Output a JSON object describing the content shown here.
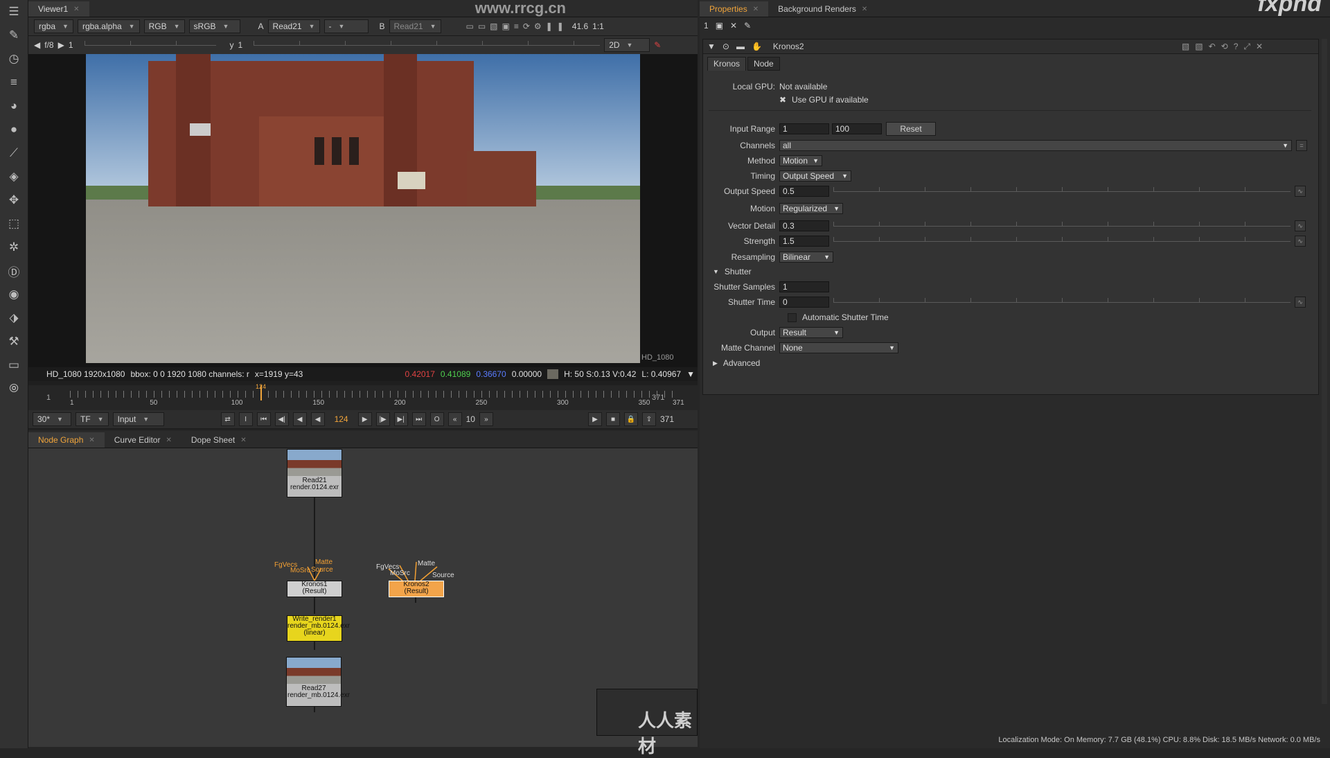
{
  "toolbar": {
    "icons": [
      "layers-icon",
      "paint-brush-icon",
      "clock-icon",
      "stack-icon",
      "sphere-icon",
      "circle-icon",
      "brush-icon",
      "layers-icon",
      "move-icon",
      "cube-icon",
      "particles-icon",
      "d-icon",
      "eye-icon",
      "tag-icon",
      "wrench-icon",
      "hdd-icon",
      "wand-icon"
    ]
  },
  "watermark": {
    "site": "www.rrcg.cn",
    "brand": "fxphd",
    "bottom_brand": "人人素材"
  },
  "viewer": {
    "tab": "Viewer1",
    "channels": "rgba",
    "alpha": "rgba.alpha",
    "colorspace": "RGB",
    "lut": "sRGB",
    "a_label": "A",
    "a_input": "Read21",
    "dash": "-",
    "b_label": "B",
    "b_input": "Read21",
    "zoom": "41.6",
    "ratio": "1:1",
    "fstop": "f/8",
    "gain": "1",
    "y_label": "y",
    "y_value": "1",
    "mode": "2D",
    "format_label": "HD_1080",
    "info_format": "HD_1080 1920x1080",
    "info_bbox": "bbox: 0 0 1920 1080 channels: r",
    "info_coords": "x=1919 y=43",
    "pixel_r": "0.42017",
    "pixel_g": "0.41089",
    "pixel_b": "0.36670",
    "pixel_a": "0.00000",
    "hsv": "H: 50 S:0.13 V:0.42",
    "lum": "L: 0.40967",
    "colors": {
      "r": "#e04343",
      "g": "#4fd14f",
      "b": "#5a7cff"
    }
  },
  "timeline": {
    "start": "1",
    "end": "371",
    "current": "124",
    "ticks": [
      "1",
      "50",
      "100",
      "150",
      "200",
      "250",
      "300",
      "350",
      "371"
    ],
    "fps": "30*",
    "tf": "TF",
    "input_mode": "Input",
    "frame": "124",
    "increment": "10",
    "end_frame": "371"
  },
  "node_graph": {
    "tabs": [
      {
        "label": "Node Graph",
        "active": true
      },
      {
        "label": "Curve Editor",
        "active": false
      },
      {
        "label": "Dope Sheet",
        "active": false
      }
    ],
    "nodes": {
      "read21": {
        "name": "Read21",
        "file": "render.0124.exr"
      },
      "kronos1": {
        "name": "Kronos1",
        "sub": "(Result)"
      },
      "kronos2": {
        "name": "Kronos2",
        "sub": "(Result)"
      },
      "write": {
        "name": "Write_render1",
        "file": "render_mb.0124.exr",
        "sub": "(linear)"
      },
      "read27": {
        "name": "Read27",
        "file": "render_mb.0124.exr"
      }
    },
    "pins": {
      "fgvecs": "FgVecs",
      "mosrc": "MoSrc",
      "matte": "Matte",
      "source": "Source"
    }
  },
  "properties": {
    "tabs": [
      {
        "label": "Properties",
        "active": true
      },
      {
        "label": "Background Renders",
        "active": false
      }
    ],
    "count": "1",
    "node_name": "Kronos2",
    "subtabs": [
      "Kronos",
      "Node"
    ],
    "local_gpu_label": "Local GPU:",
    "local_gpu_value": "Not available",
    "use_gpu": "Use GPU if available",
    "input_range_label": "Input Range",
    "input_range_start": "1",
    "input_range_end": "100",
    "reset": "Reset",
    "channels_label": "Channels",
    "channels_value": "all",
    "method_label": "Method",
    "method_value": "Motion",
    "timing_label": "Timing",
    "timing_value": "Output Speed",
    "output_speed_label": "Output Speed",
    "output_speed_value": "0.5",
    "motion_label": "Motion",
    "motion_value": "Regularized",
    "vector_detail_label": "Vector Detail",
    "vector_detail_value": "0.3",
    "strength_label": "Strength",
    "strength_value": "1.5",
    "resampling_label": "Resampling",
    "resampling_value": "Bilinear",
    "shutter_group": "Shutter",
    "shutter_samples_label": "Shutter Samples",
    "shutter_samples_value": "1",
    "shutter_time_label": "Shutter Time",
    "shutter_time_value": "0",
    "auto_shutter": "Automatic Shutter Time",
    "output_label": "Output",
    "output_value": "Result",
    "matte_channel_label": "Matte Channel",
    "matte_channel_value": "None",
    "advanced_group": "Advanced"
  },
  "status_bar": "Localization Mode: On  Memory: 7.7 GB (48.1%)  CPU: 8.8%  Disk: 18.5 MB/s  Network: 0.0 MB/s"
}
